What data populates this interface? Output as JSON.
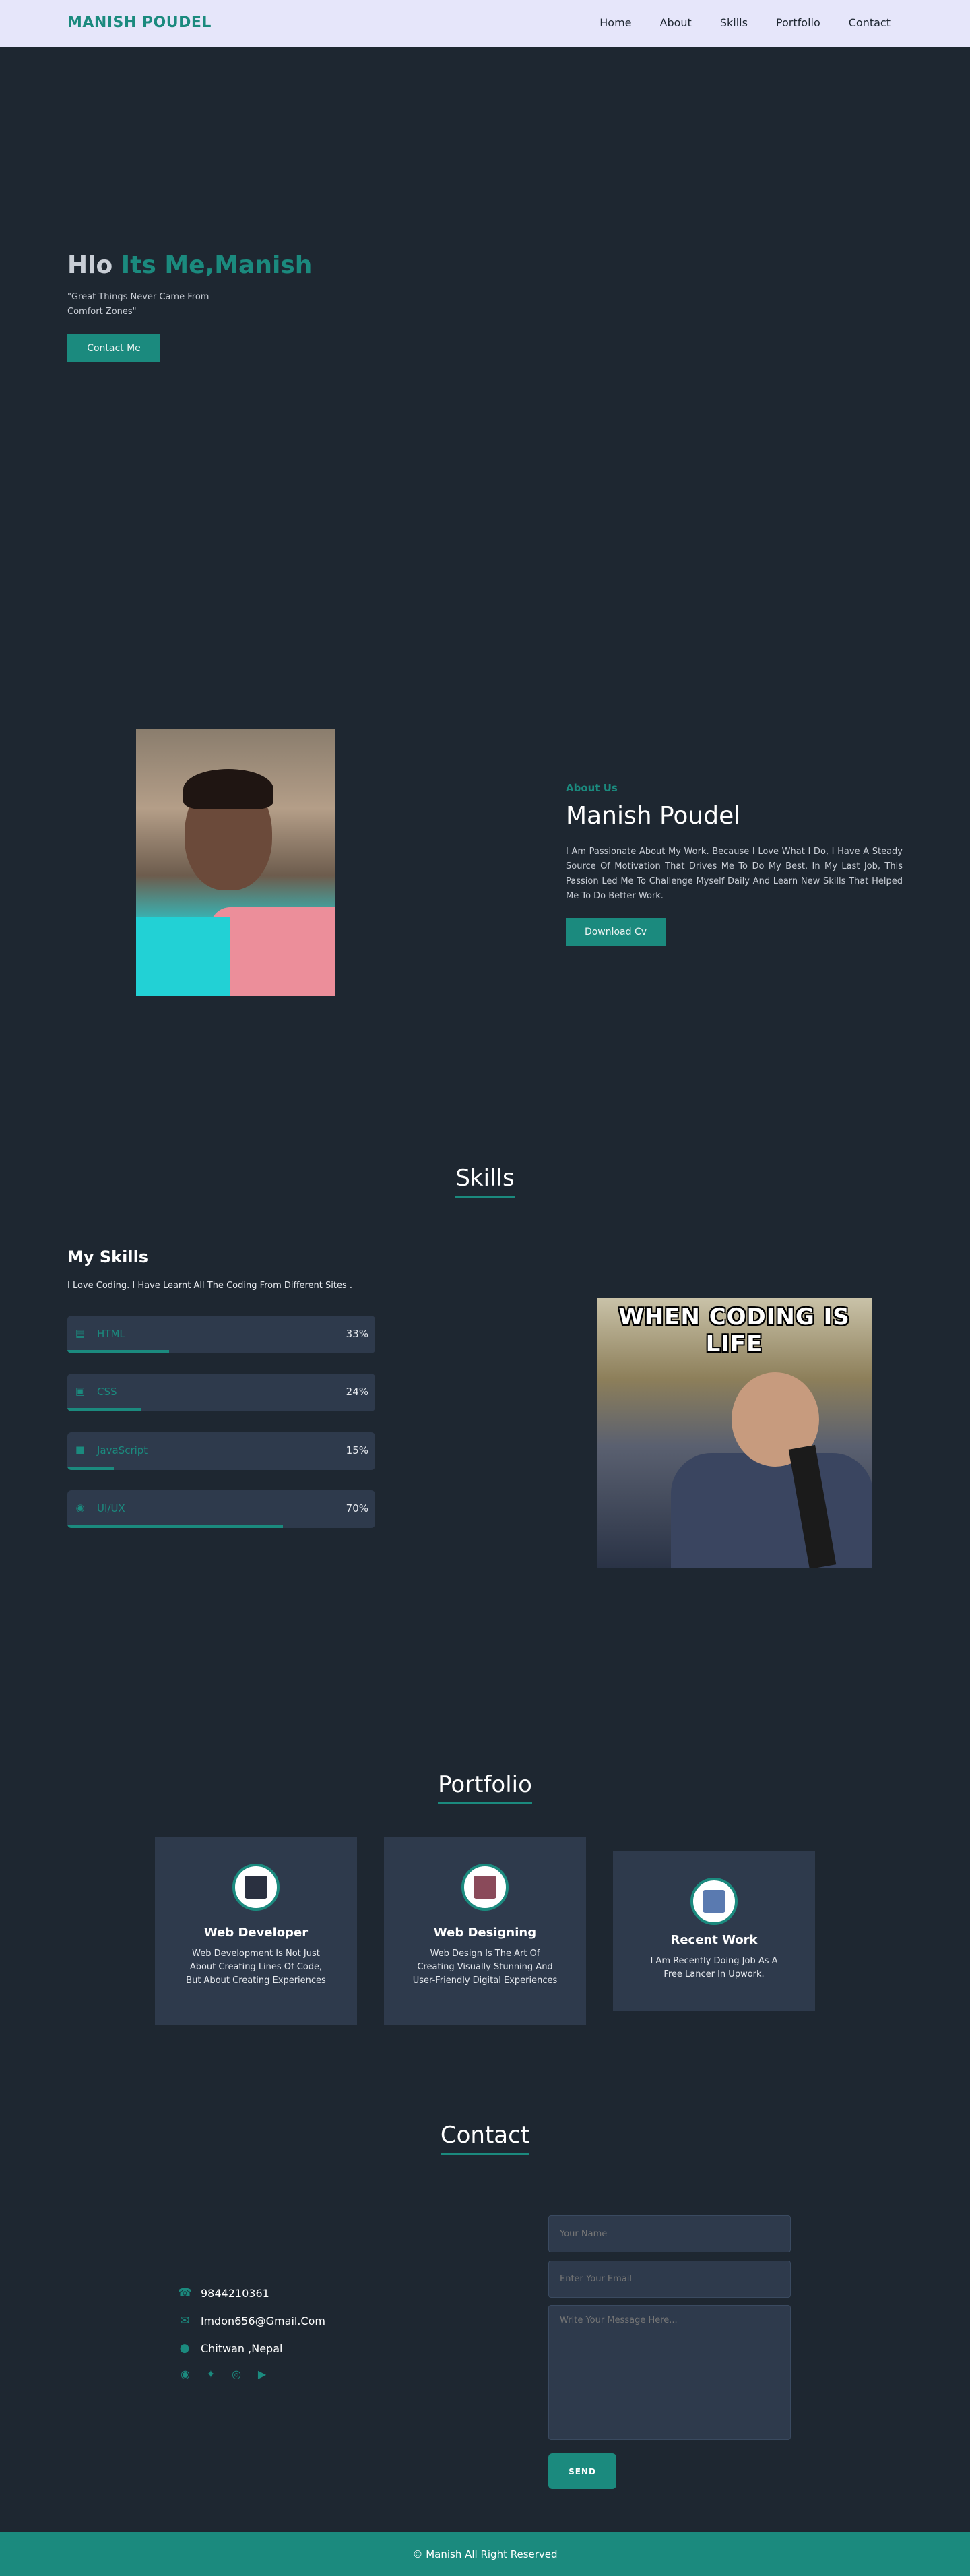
{
  "nav": {
    "brand": "MANISH POUDEL",
    "links": [
      "Home",
      "About",
      "Skills",
      "Portfolio",
      "Contact"
    ]
  },
  "hero": {
    "greeting": "Hlo",
    "name_highlight": "Its Me,Manish",
    "quote": "\"Great Things Never Came From Comfort Zones\"",
    "button": "Contact Me"
  },
  "about": {
    "subtitle": "About Us",
    "name": "Manish Poudel",
    "text": "I Am Passionate About My Work. Because I Love What I Do, I Have A Steady Source Of Motivation That Drives Me To Do My Best. In My Last Job, This Passion Led Me To Challenge Myself Daily And Learn New Skills That Helped Me To Do Better Work.",
    "button": "Download Cv"
  },
  "skills": {
    "section_title": "Skills",
    "heading": "My Skills",
    "intro": "I Love Coding. I Have Learnt All The Coding From Different Sites .",
    "items": [
      {
        "name": "HTML",
        "percent": "33%",
        "value": 33,
        "icon": "html-icon"
      },
      {
        "name": "CSS",
        "percent": "24%",
        "value": 24,
        "icon": "css-icon"
      },
      {
        "name": "JavaScript",
        "percent": "15%",
        "value": 15,
        "icon": "js-icon"
      },
      {
        "name": "UI/UX",
        "percent": "70%",
        "value": 70,
        "icon": "palette-icon"
      }
    ],
    "meme_caption": "WHEN CODING IS LIFE"
  },
  "portfolio": {
    "section_title": "Portfolio",
    "cards": [
      {
        "title": "Web Developer",
        "text": "Web Development Is Not Just About Creating Lines Of Code, But About Creating Experiences"
      },
      {
        "title": "Web Designing",
        "text": "Web Design Is The Art Of Creating Visually Stunning And User-Friendly Digital Experiences"
      },
      {
        "title": "Recent Work",
        "text": "I Am Recently Doing Job As A Free Lancer In Upwork."
      }
    ]
  },
  "contact": {
    "section_title": "Contact",
    "phone": "9844210361",
    "email": "lmdon656@Gmail.Com",
    "location": "Chitwan ,Nepal",
    "name_placeholder": "Your Name",
    "email_placeholder": "Enter Your Email",
    "message_placeholder": "Write Your Message Here...",
    "send": "SEND"
  },
  "footer": {
    "text": "© Manish All Right Reserved"
  },
  "colors": {
    "accent": "#1b8a7e",
    "background": "#1e2731",
    "card": "#2e3a4c",
    "nav_background": "#e6e6fa"
  }
}
